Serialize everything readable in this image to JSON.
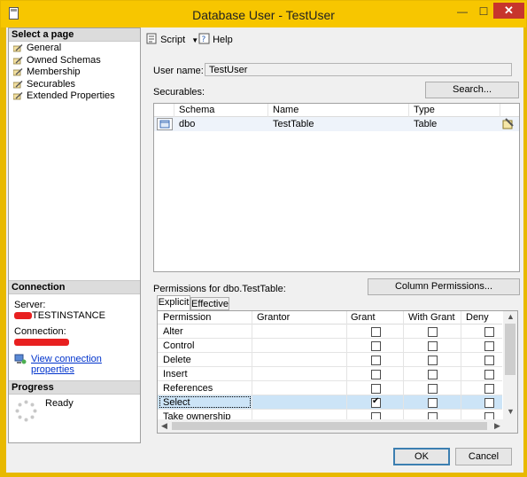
{
  "window": {
    "title": "Database User - TestUser",
    "minimize_glyph": "—",
    "maximize_glyph": "☐",
    "close_glyph": "✕"
  },
  "left": {
    "select_page_header": "Select a page",
    "pages": [
      {
        "label": "General"
      },
      {
        "label": "Owned Schemas"
      },
      {
        "label": "Membership"
      },
      {
        "label": "Securables"
      },
      {
        "label": "Extended Properties"
      }
    ],
    "connection_header": "Connection",
    "server_label": "Server:",
    "server_value": "TESTINSTANCE",
    "connection_label": "Connection:",
    "view_connection_link": "View connection properties",
    "progress_header": "Progress",
    "progress_status": "Ready"
  },
  "toolbar": {
    "script_label": "Script",
    "help_label": "Help"
  },
  "form": {
    "user_name_label": "User name:",
    "user_name_value": "TestUser",
    "securables_label": "Securables:",
    "search_button": "Search..."
  },
  "securables_grid": {
    "columns": [
      "Schema",
      "Name",
      "Type"
    ],
    "rows": [
      {
        "schema": "dbo",
        "name": "TestTable",
        "type": "Table"
      }
    ]
  },
  "permissions": {
    "label": "Permissions for dbo.TestTable:",
    "column_permissions_button": "Column Permissions...",
    "tabs": [
      {
        "label": "Explicit",
        "active": true
      },
      {
        "label": "Effective",
        "active": false
      }
    ],
    "columns": [
      "Permission",
      "Grantor",
      "Grant",
      "With Grant",
      "Deny"
    ],
    "rows": [
      {
        "permission": "Alter",
        "grant": false,
        "with_grant": false,
        "deny": false
      },
      {
        "permission": "Control",
        "grant": false,
        "with_grant": false,
        "deny": false
      },
      {
        "permission": "Delete",
        "grant": false,
        "with_grant": false,
        "deny": false
      },
      {
        "permission": "Insert",
        "grant": false,
        "with_grant": false,
        "deny": false
      },
      {
        "permission": "References",
        "grant": false,
        "with_grant": false,
        "deny": false
      },
      {
        "permission": "Select",
        "grant": true,
        "with_grant": false,
        "deny": false
      },
      {
        "permission": "Take ownership",
        "grant": false,
        "with_grant": false,
        "deny": false
      }
    ],
    "selected_row": "Select"
  },
  "buttons": {
    "ok": "OK",
    "cancel": "Cancel"
  },
  "colors": {
    "title_bar": "#f7c600",
    "close_button": "#c7352c",
    "selection": "#cce4f7",
    "link": "#0033cc",
    "redaction": "#e82020"
  }
}
